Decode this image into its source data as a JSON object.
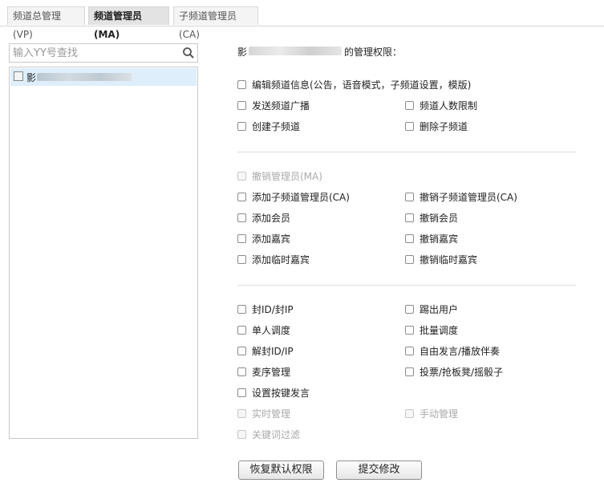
{
  "tabs": [
    {
      "label": "频道总管理(VP)",
      "active": false
    },
    {
      "label": "频道管理员(MA)",
      "active": true
    },
    {
      "label": "子频道管理员(CA)",
      "active": false
    }
  ],
  "search": {
    "placeholder": "输入YY号查找",
    "icon": "search-icon"
  },
  "users": [
    {
      "label": "影"
    }
  ],
  "permissions": {
    "heading_prefix": "影",
    "heading_suffix": "的管理权限：",
    "group1": [
      "编辑频道信息(公告，语音模式，子频道设置，模版)",
      "发送频道广播",
      "频道人数限制",
      "创建子频道",
      "删除子频道"
    ],
    "group2": [
      "撤销管理员(MA)",
      "添加子频道管理员(CA)",
      "撤销子频道管理员(CA)",
      "添加会员",
      "撤销会员",
      "添加嘉宾",
      "撤销嘉宾",
      "添加临时嘉宾",
      "撤销临时嘉宾"
    ],
    "group3": [
      "封ID/封IP",
      "踢出用户",
      "单人调度",
      "批量调度",
      "解封ID/IP",
      "自由发言/播放伴奏",
      "麦序管理",
      "投票/抢板凳/摇骰子",
      "设置按键发言",
      "实时管理",
      "手动管理",
      "关键词过滤"
    ]
  },
  "buttons": {
    "restore": "恢复默认权限",
    "submit": "提交修改"
  }
}
